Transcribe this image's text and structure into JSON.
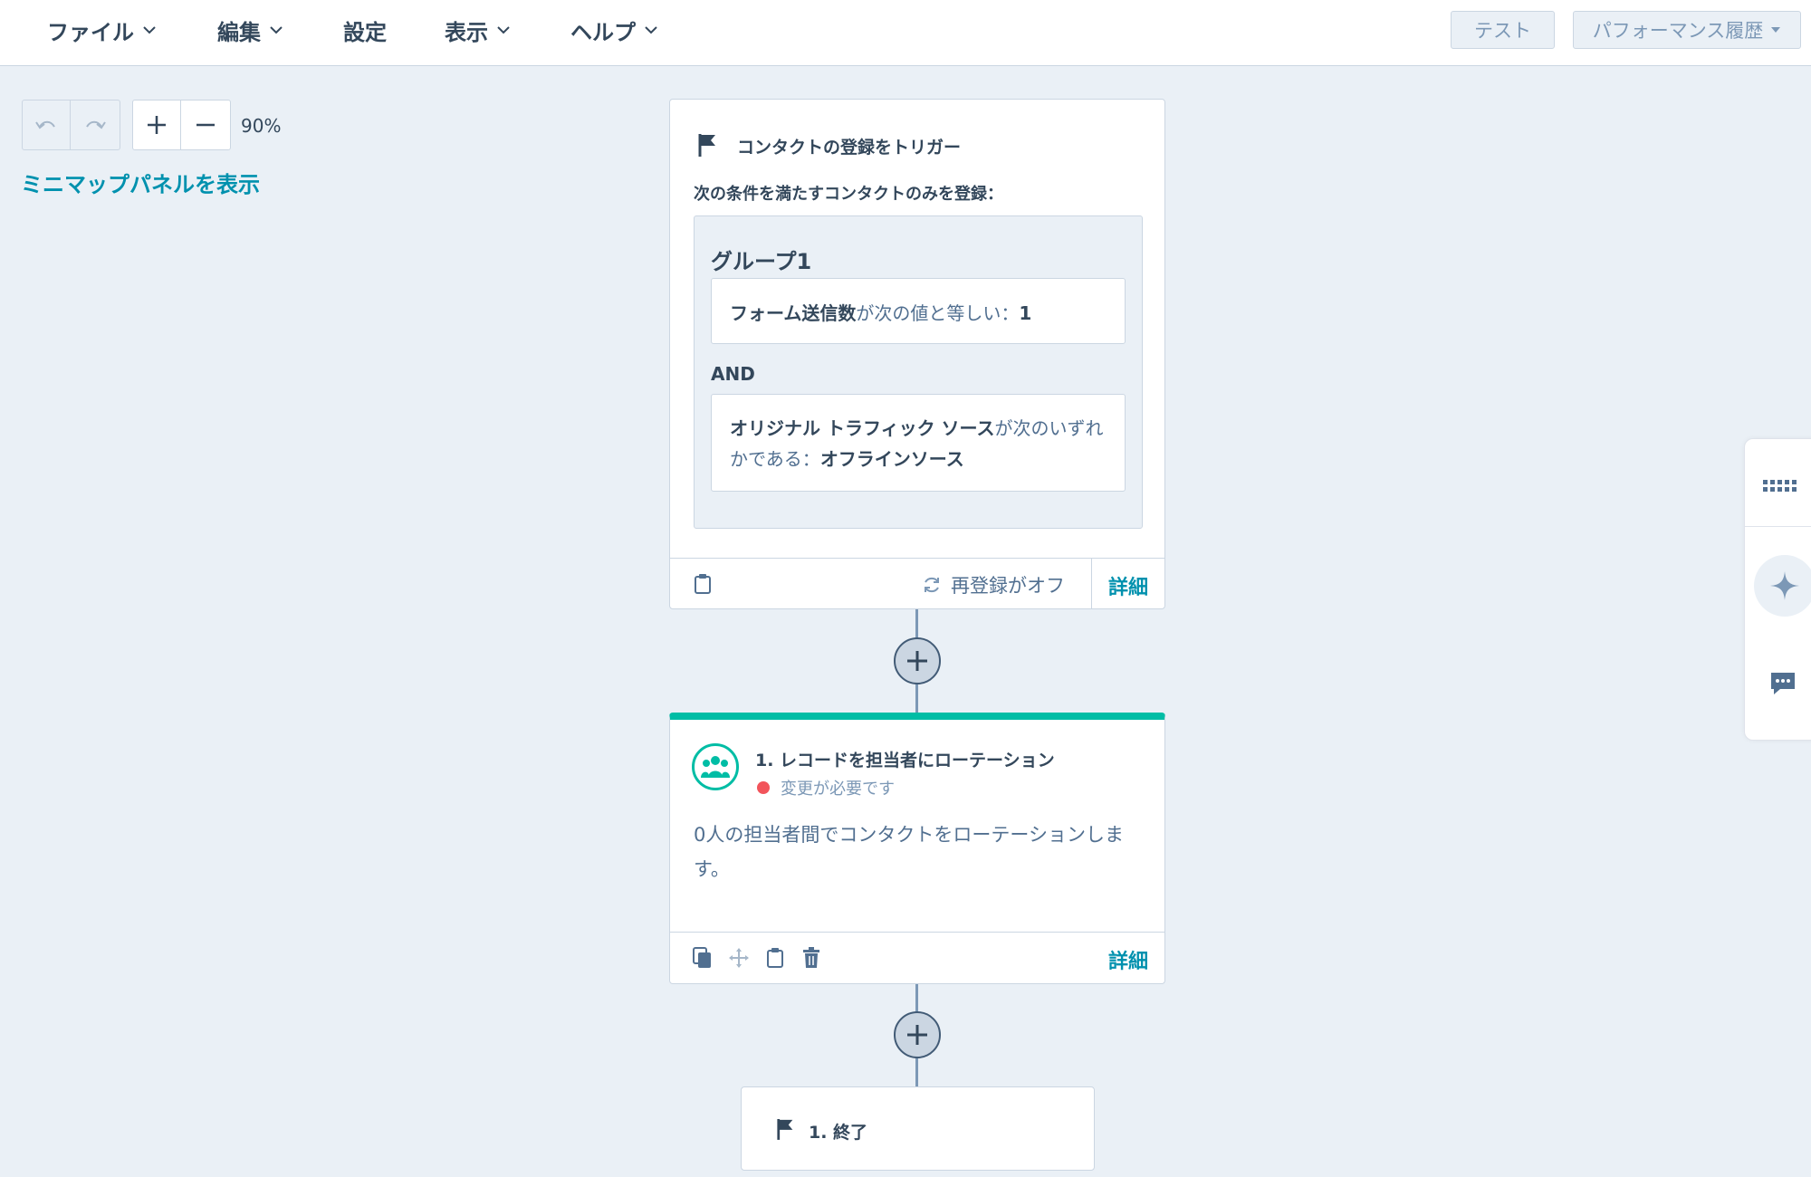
{
  "menu": {
    "file": "ファイル",
    "edit": "編集",
    "settings": "設定",
    "view": "表示",
    "help": "ヘルプ"
  },
  "top_buttons": {
    "test": "テスト",
    "performance_history": "パフォーマンス履歴"
  },
  "canvas_controls": {
    "zoom_level": "90%",
    "minimap_link": "ミニマップパネルを表示"
  },
  "trigger_card": {
    "title": "コンタクトの登録をトリガー",
    "subtitle": "次の条件を満たすコンタクトのみを登録：",
    "group_title": "グループ1",
    "condition1": {
      "property": "フォーム送信数",
      "operator": "が次の値と等しい：",
      "value": "1"
    },
    "and_label": "AND",
    "condition2": {
      "property": "オリジナル トラフィック ソース",
      "operator": "が次のいずれかである：",
      "value": "オフラインソース"
    },
    "reenroll": "再登録がオフ",
    "details": "詳細"
  },
  "action_card": {
    "title": "1. レコードを担当者にローテーション",
    "status": "変更が必要です",
    "body": "0人の担当者間でコンタクトをローテーションします。",
    "details": "詳細"
  },
  "end_card": {
    "title": "1. 終了"
  },
  "colors": {
    "accent_teal": "#00bda5",
    "link": "#0091ae",
    "status_red": "#f2545b",
    "text": "#33475b"
  }
}
